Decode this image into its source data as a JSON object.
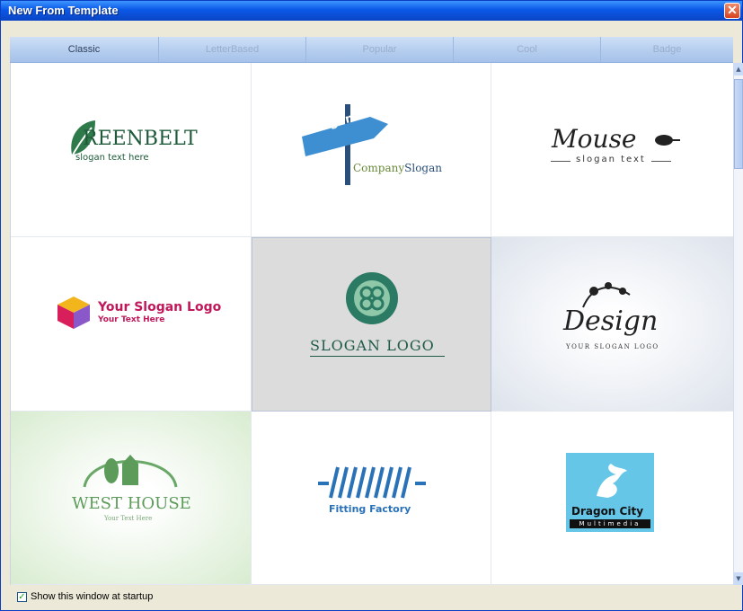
{
  "window": {
    "title": "New From Template"
  },
  "tabs": [
    {
      "label": "Classic",
      "active": true
    },
    {
      "label": "LetterBased",
      "active": false
    },
    {
      "label": "Popular",
      "active": false
    },
    {
      "label": "Cool",
      "active": false
    },
    {
      "label": "Badge",
      "active": false
    }
  ],
  "templates": {
    "greenbelt": {
      "name": "GREENBELT",
      "initial": "G",
      "rest": "REENBELT",
      "slogan": "slogan text here",
      "color": "#1e5a3a"
    },
    "slogan_sign": {
      "sign": "Slogan",
      "company": "Company",
      "slogan": "Slogan",
      "color": "#2a7bb8"
    },
    "mouse": {
      "name": "Mouse",
      "initial": "M",
      "rest": "ouse",
      "slogan": "slogan text"
    },
    "ysl": {
      "title": "Your Slogan Logo",
      "subtitle": "Your Text Here",
      "color": "#c0185a"
    },
    "slogan_logo": {
      "title": "SLOGAN LOGO",
      "color": "#1f5a48"
    },
    "design": {
      "title": "Design",
      "subtitle": "YOUR SLOGAN LOGO"
    },
    "westhouse": {
      "title": "WEST HOUSE",
      "subtitle": "Your Text Here",
      "color": "#5c9b5a"
    },
    "fitting": {
      "title": "Fitting Factory",
      "color": "#2a72b8"
    },
    "dragon": {
      "title": "Dragon City",
      "subtitle": "Multimedia",
      "bg": "#66c6e8"
    }
  },
  "footer": {
    "startup_label": "Show this window at startup",
    "startup_checked": true
  }
}
